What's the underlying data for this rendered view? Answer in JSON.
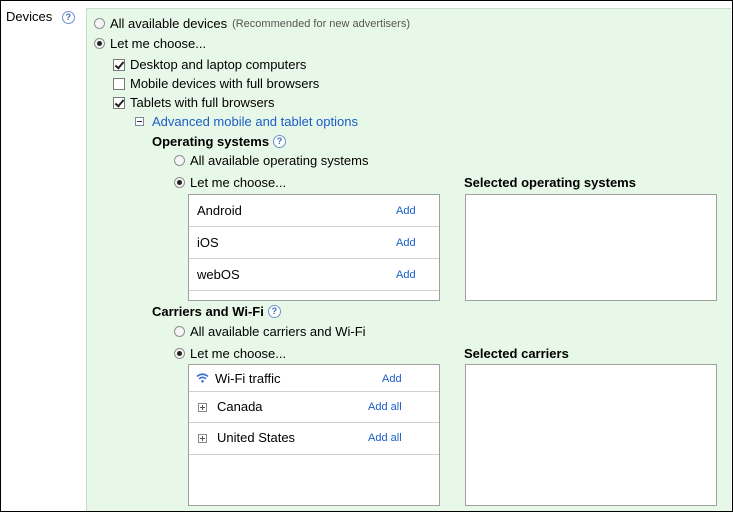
{
  "devices": {
    "label": "Devices",
    "help": "?",
    "all_label": "All available devices",
    "all_note": "(Recommended for new advertisers)",
    "choose_label": "Let me choose...",
    "options": [
      {
        "label": "Desktop and laptop computers",
        "checked": true
      },
      {
        "label": "Mobile devices with full browsers",
        "checked": false
      },
      {
        "label": "Tablets with full browsers",
        "checked": true
      }
    ],
    "advanced_link": "Advanced mobile and tablet options"
  },
  "os": {
    "heading": "Operating systems",
    "help": "?",
    "all_label": "All available operating systems",
    "choose_label": "Let me choose...",
    "selected_heading": "Selected operating systems",
    "items": [
      {
        "name": "Android",
        "action": "Add"
      },
      {
        "name": "iOS",
        "action": "Add"
      },
      {
        "name": "webOS",
        "action": "Add"
      }
    ]
  },
  "carriers": {
    "heading": "Carriers and Wi-Fi",
    "help": "?",
    "all_label": "All available carriers and Wi-Fi",
    "choose_label": "Let me choose...",
    "selected_heading": "Selected carriers",
    "items": [
      {
        "name": "Wi-Fi traffic",
        "action": "Add",
        "icon": "wifi-icon"
      },
      {
        "name": "Canada",
        "action": "Add all",
        "icon": "expand-plus-icon"
      },
      {
        "name": "United States",
        "action": "Add all",
        "icon": "expand-plus-icon"
      }
    ]
  },
  "colors": {
    "panel_bg": "#e8f8e8",
    "link": "#1a5cc8"
  }
}
